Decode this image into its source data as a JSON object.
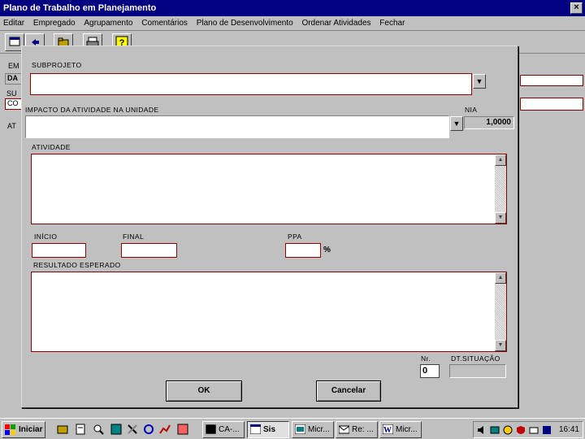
{
  "window": {
    "title": "Plano de Trabalho em Planejamento",
    "close_glyph": "×"
  },
  "menu": [
    "Editar",
    "Agrupamento",
    "Agrupamento",
    "Comentários",
    "Plano de Desenvolvimento",
    "Ordenar Atividades",
    "Fechar"
  ],
  "menu_items": [
    "Editar",
    "Empregado",
    "Agrupamento",
    "Comentários",
    "Plano de Desenvolvimento",
    "Ordenar Atividades",
    "Fechar"
  ],
  "background": {
    "label_em": "EM",
    "label_da": "DA",
    "label_su": "SU",
    "field_co": "CO",
    "label_at": "AT"
  },
  "dialog": {
    "subprojeto_label": "SUBPROJETO",
    "impacto_label": "IMPACTO DA ATIVIDADE NA UNIDADE",
    "nia_label": "NIA",
    "nia_value": "1,0000",
    "atividade_label": "ATIVIDADE",
    "inicio_label": "INÍCIO",
    "final_label": "FINAL",
    "ppa_label": "PPA",
    "percent_sign": "%",
    "resultado_label": "RESULTADO ESPERADO",
    "nr_label": "Nr.",
    "nr_value": "0",
    "dt_situacao_label": "DT.SITUAÇÃO",
    "ok_label": "OK",
    "cancel_label": "Cancelar",
    "dropdown_glyph": "▼",
    "scroll_up_glyph": "▲",
    "scroll_down_glyph": "▼"
  },
  "taskbar": {
    "start_label": "Iniciar",
    "tasks": [
      "CA-...",
      "Sis",
      "Micr...",
      "Re: ...",
      "Micr..."
    ],
    "clock": "16:41"
  },
  "colors": {
    "titlebar": "#000080",
    "field_border": "#8b0000",
    "face": "#c0c0c0"
  },
  "icons": [
    "close-icon",
    "dropdown-arrow-icon",
    "scroll-up-icon",
    "scroll-down-icon",
    "windows-logo-icon"
  ]
}
